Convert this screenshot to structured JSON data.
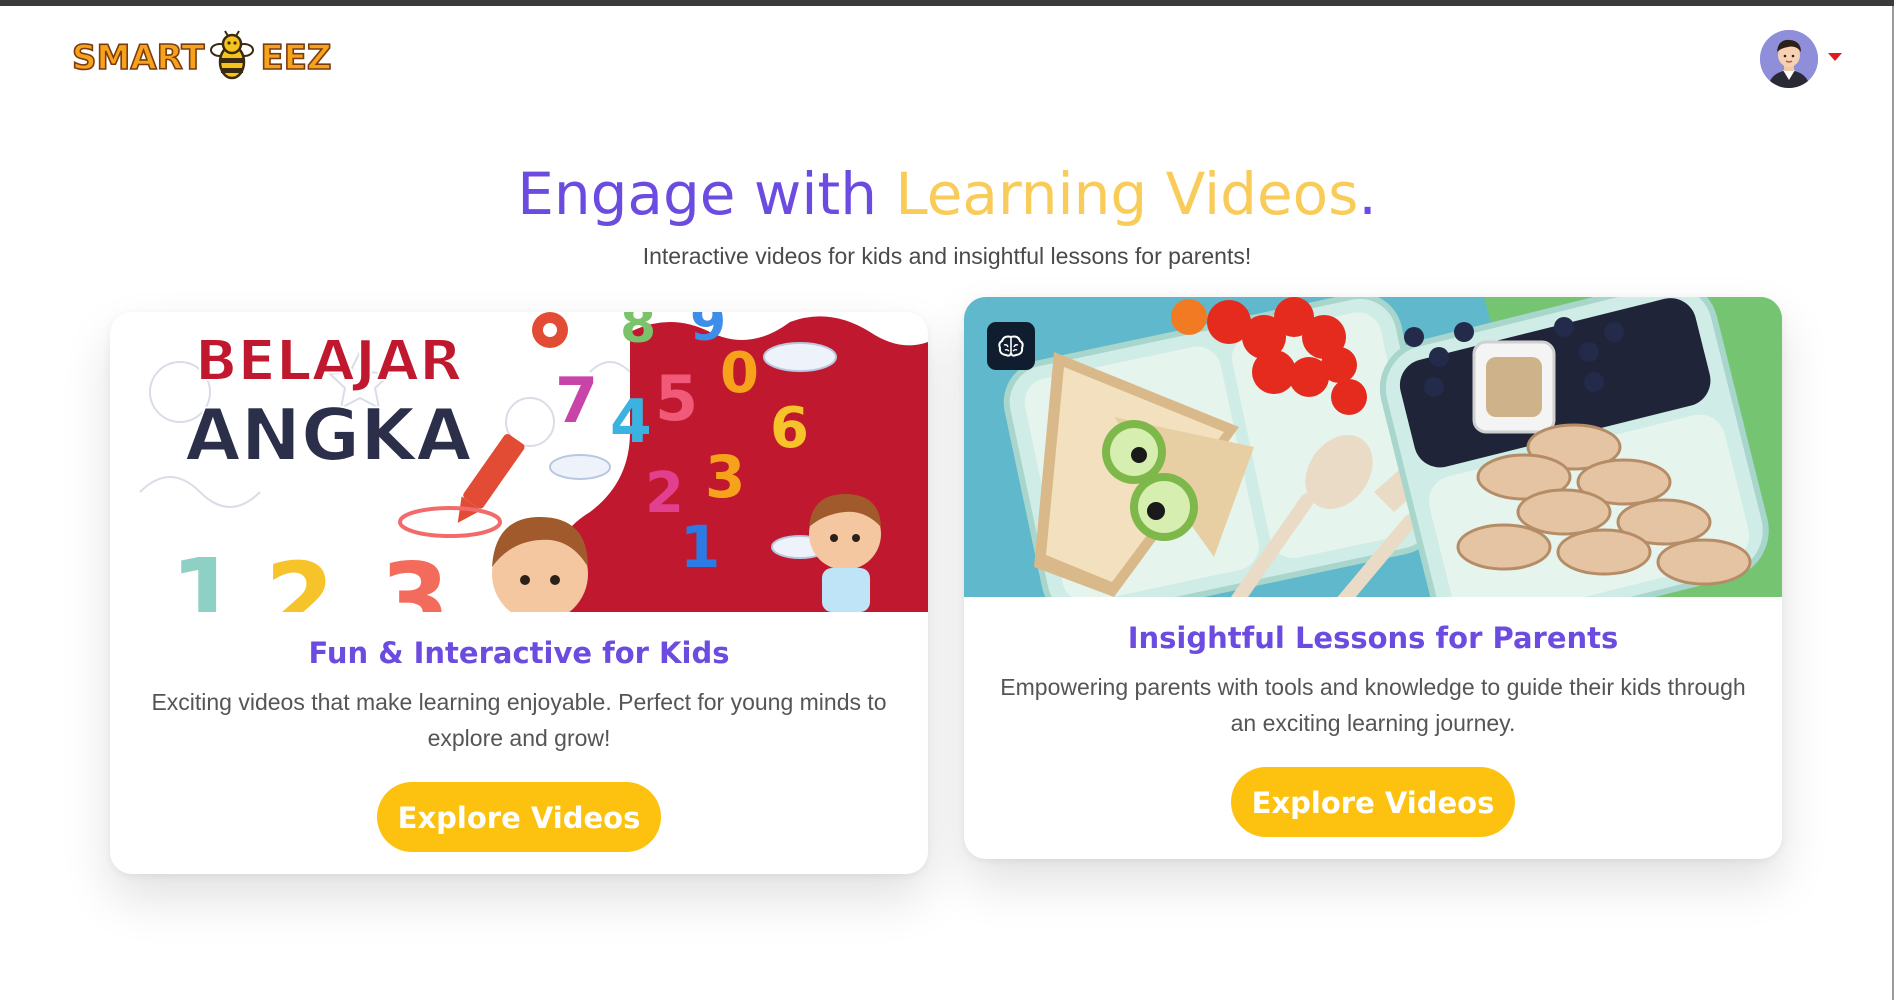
{
  "brand": {
    "name": "SMART BEEZ",
    "text_left": "SMART",
    "text_right": "EEZ",
    "icon": "bee-icon"
  },
  "header": {
    "avatar_icon": "user-avatar-icon",
    "menu_icon": "caret-down-icon"
  },
  "hero": {
    "title_part1": "Engage with ",
    "title_part2": "Learning Videos",
    "title_part3": ".",
    "subtitle": "Interactive videos for kids and insightful lessons for parents!"
  },
  "cards": [
    {
      "image_text_line1": "BELAJAR",
      "image_text_line2": "ANGKA",
      "title": "Fun & Interactive for Kids",
      "description": "Exciting videos that make learning enjoyable. Perfect for young minds to explore and grow!",
      "button_label": "Explore Videos"
    },
    {
      "badge_icon": "brain-icon",
      "title": "Insightful Lessons for Parents",
      "description": "Empowering parents with tools and knowledge to guide their kids through an exciting learning journey.",
      "button_label": "Explore Videos"
    }
  ],
  "colors": {
    "primary_purple": "#6c4ce0",
    "accent_yellow": "#f9cc5a",
    "button_yellow": "#fcc20f"
  }
}
